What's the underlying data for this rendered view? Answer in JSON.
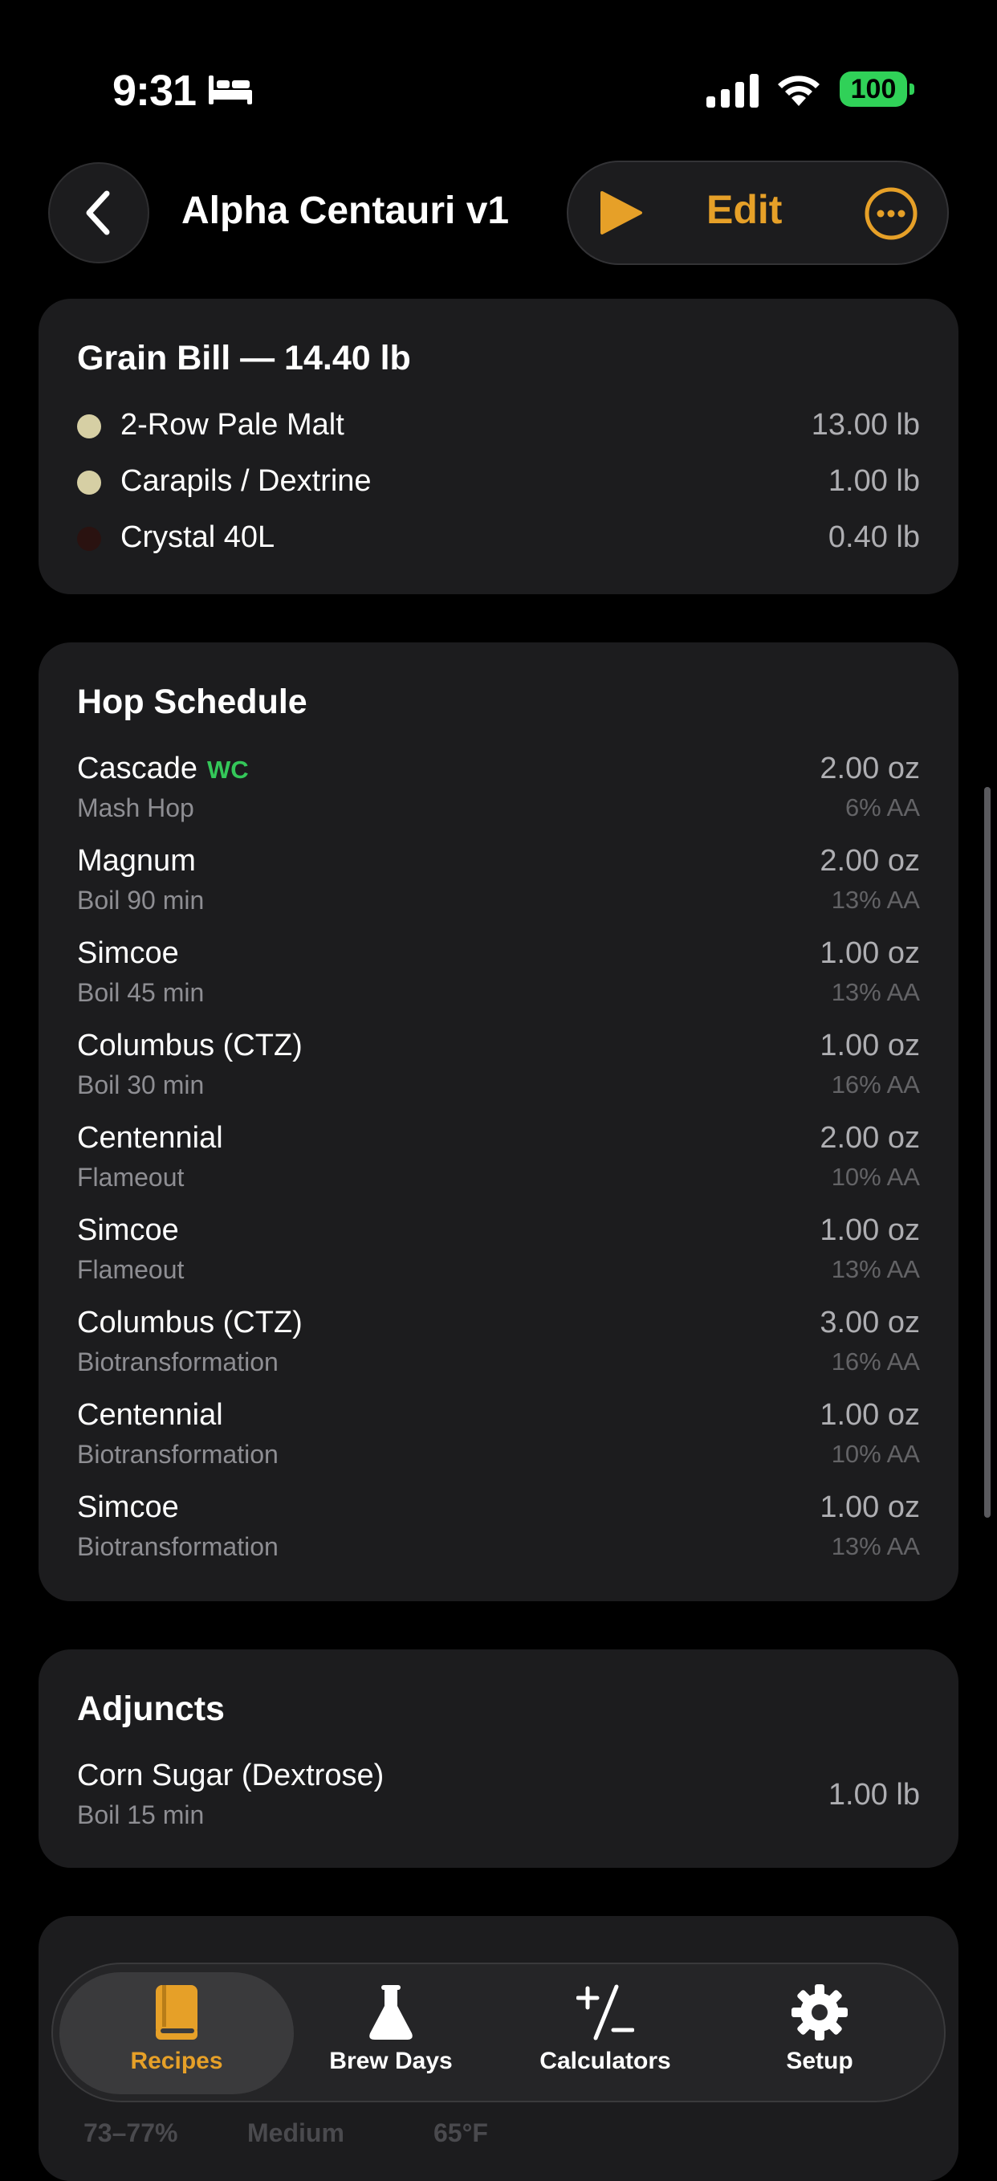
{
  "status": {
    "time": "9:31",
    "battery": "100"
  },
  "nav": {
    "title": "Alpha Centauri v1",
    "edit_label": "Edit"
  },
  "grain": {
    "title": "Grain Bill — 14.40 lb",
    "items": [
      {
        "name": "2-Row Pale Malt",
        "amount": "13.00 lb",
        "color": "#d6cfa4"
      },
      {
        "name": "Carapils / Dextrine",
        "amount": "1.00 lb",
        "color": "#d6cfa4"
      },
      {
        "name": "Crystal 40L",
        "amount": "0.40 lb",
        "color": "#2a1210"
      }
    ]
  },
  "hops": {
    "title": "Hop Schedule",
    "items": [
      {
        "name": "Cascade",
        "tag": "WC",
        "use": "Mash Hop",
        "amount": "2.00 oz",
        "aa": "6% AA"
      },
      {
        "name": "Magnum",
        "use": "Boil 90 min",
        "amount": "2.00 oz",
        "aa": "13% AA"
      },
      {
        "name": "Simcoe",
        "use": "Boil 45 min",
        "amount": "1.00 oz",
        "aa": "13% AA"
      },
      {
        "name": "Columbus (CTZ)",
        "use": "Boil 30 min",
        "amount": "1.00 oz",
        "aa": "16% AA"
      },
      {
        "name": "Centennial",
        "use": "Flameout",
        "amount": "2.00 oz",
        "aa": "10% AA"
      },
      {
        "name": "Simcoe",
        "use": "Flameout",
        "amount": "1.00 oz",
        "aa": "13% AA"
      },
      {
        "name": "Columbus (CTZ)",
        "use": "Biotransformation",
        "amount": "3.00 oz",
        "aa": "16% AA"
      },
      {
        "name": "Centennial",
        "use": "Biotransformation",
        "amount": "1.00 oz",
        "aa": "10% AA"
      },
      {
        "name": "Simcoe",
        "use": "Biotransformation",
        "amount": "1.00 oz",
        "aa": "13% AA"
      }
    ]
  },
  "adjuncts": {
    "title": "Adjuncts",
    "items": [
      {
        "name": "Corn Sugar (Dextrose)",
        "use": "Boil 15 min",
        "amount": "1.00 lb"
      }
    ]
  },
  "peek": {
    "attenuation": "73–77%",
    "flocculation": "Medium",
    "temp": "65°F"
  },
  "tabs": [
    {
      "label": "Recipes",
      "icon": "book-icon",
      "active": true
    },
    {
      "label": "Brew Days",
      "icon": "flask-icon",
      "active": false
    },
    {
      "label": "Calculators",
      "icon": "plus-minus-icon",
      "active": false
    },
    {
      "label": "Setup",
      "icon": "gear-icon",
      "active": false
    }
  ],
  "colors": {
    "accent": "#e6a028",
    "card": "#1c1c1e",
    "tag": "#34c759",
    "battery": "#30d158"
  }
}
